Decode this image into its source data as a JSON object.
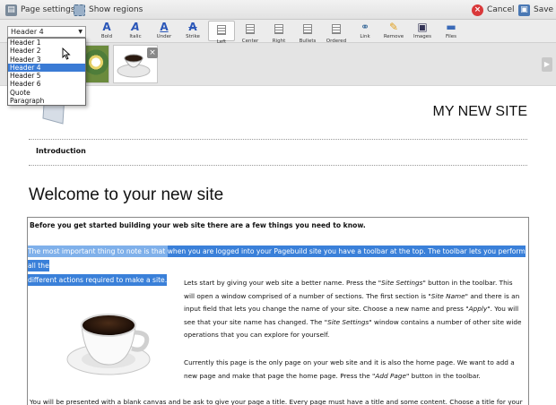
{
  "topbar": {
    "page_settings": "Page settings",
    "show_regions": "Show regions",
    "cancel": "Cancel",
    "save": "Save"
  },
  "format_select": {
    "value": "Header 4",
    "options": [
      "Header 1",
      "Header 2",
      "Header 3",
      "Header 4",
      "Header 5",
      "Header 6",
      "Quote",
      "Paragraph"
    ],
    "selected_index": 3
  },
  "toolbar": {
    "buttons": [
      {
        "label": "Bold",
        "glyph": "A"
      },
      {
        "label": "Italic",
        "glyph": "A"
      },
      {
        "label": "Under",
        "glyph": "A"
      },
      {
        "label": "Strike",
        "glyph": "A"
      },
      {
        "label": "Left",
        "glyph": ""
      },
      {
        "label": "Center",
        "glyph": ""
      },
      {
        "label": "Right",
        "glyph": ""
      },
      {
        "label": "Bullets",
        "glyph": ""
      },
      {
        "label": "Ordered",
        "glyph": ""
      },
      {
        "label": "Link",
        "glyph": ""
      },
      {
        "label": "Remove",
        "glyph": ""
      },
      {
        "label": "Images",
        "glyph": ""
      },
      {
        "label": "Files",
        "glyph": ""
      }
    ]
  },
  "page": {
    "site_title": "MY NEW SITE",
    "nav_item": "Introduction",
    "heading": "Welcome to your new site",
    "intro": "Before you get started building your web site there are a few things you need to know.",
    "highlight_1a": "The most important thing to note is that ",
    "highlight_1b": "when you are logged into your Pagebuild site you have a toolbar at the top. The toolbar lets you perform all the",
    "highlight_2": "different actions required to make a site.",
    "para1_a": "Lets start by giving your web site a better name. Press the \"",
    "para1_em1": "Site Settings",
    "para1_b": "\" button in the toolbar. This will open a window comprised of a number of sections. The first section is \"",
    "para1_em2": "Site Name",
    "para1_c": "\" and there is an input field that lets you change the name of your site. Choose a new name and press \"",
    "para1_em3": "Apply",
    "para1_d": "\". You will see that your site name has changed. The \"",
    "para1_em4": "Site Settings",
    "para1_e": "\" window contains a number of other site wide operations that you can explore for yourself.",
    "para2_a": "Currently this page is the only page on your web site and it is also the home page. We want to add a new page and make that page the home page. Press the \"",
    "para2_em": "Add Page",
    "para2_b": "\" button in the toolbar.",
    "para3": "You will be presented with a blank canvas and be ask to give your page a title. Every page must have a title and some content. Choose a title for your"
  }
}
